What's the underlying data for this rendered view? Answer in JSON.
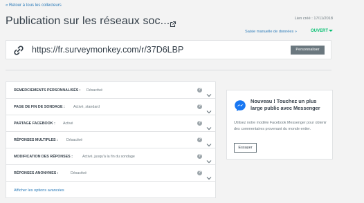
{
  "header": {
    "back_link": "« Retour à tous les collecteurs",
    "title": "Publication sur les réseaux soc...",
    "created": "Lien créé : 17/11/2018",
    "manual_entry": "Saisie manuelle de données »",
    "status": "OUVERT"
  },
  "link": {
    "url": "https://fr.surveymonkey.com/r/37D6LBP",
    "customize_label": "Personnaliser"
  },
  "options": [
    {
      "label": "REMERCIEMENTS PERSONNALISÉS :",
      "value": "Désactivé"
    },
    {
      "label": "PAGE DE FIN DE SONDAGE :",
      "value": "Activé, standard"
    },
    {
      "label": "PARTAGE FACEBOOK :",
      "value": "Activé"
    },
    {
      "label": "RÉPONSES MULTIPLES :",
      "value": "Désactivé"
    },
    {
      "label": "MODIFICATION DES RÉPONSES :",
      "value": "Activé, jusqu'à la fin du sondage"
    },
    {
      "label": "RÉPONSES ANONYMES :",
      "value": "Désactivé"
    }
  ],
  "advanced_link": "Afficher les options avancées",
  "messenger": {
    "title": "Nouveau ! Touchez un plus large public avec Messenger",
    "description": "Utilisez notre modèle Facebook Messenger pour obtenir des commentaires provenant du monde entier.",
    "button_label": "Essayer"
  },
  "colors": {
    "link": "#2b7bb9",
    "open_status": "#00bf6f",
    "messenger_blue": "#1877f2"
  },
  "icons": {
    "back": "none",
    "edit": "external-link-icon",
    "link": "chain-link-icon",
    "help": "question-circle-icon",
    "expand": "chevron-down-icon",
    "messenger": "messenger-icon"
  }
}
